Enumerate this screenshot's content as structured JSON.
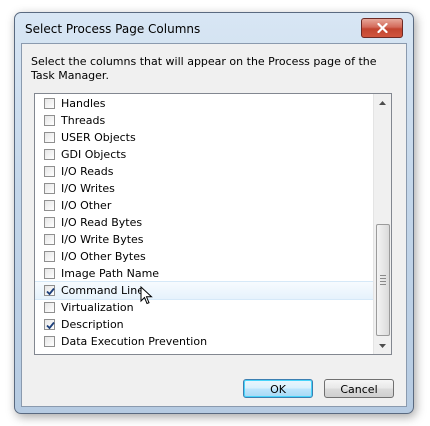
{
  "window": {
    "title": "Select Process Page Columns"
  },
  "instruction": "Select the columns that will appear on the Process page of the Task Manager.",
  "columns": [
    {
      "label": "Handles",
      "checked": false
    },
    {
      "label": "Threads",
      "checked": false
    },
    {
      "label": "USER Objects",
      "checked": false
    },
    {
      "label": "GDI Objects",
      "checked": false
    },
    {
      "label": "I/O Reads",
      "checked": false
    },
    {
      "label": "I/O Writes",
      "checked": false
    },
    {
      "label": "I/O Other",
      "checked": false
    },
    {
      "label": "I/O Read Bytes",
      "checked": false
    },
    {
      "label": "I/O Write Bytes",
      "checked": false
    },
    {
      "label": "I/O Other Bytes",
      "checked": false
    },
    {
      "label": "Image Path Name",
      "checked": false
    },
    {
      "label": "Command Line",
      "checked": true,
      "hovered": true
    },
    {
      "label": "Virtualization",
      "checked": false
    },
    {
      "label": "Description",
      "checked": true
    },
    {
      "label": "Data Execution Prevention",
      "checked": false
    }
  ],
  "buttons": {
    "ok": "OK",
    "cancel": "Cancel"
  },
  "colors": {
    "accent": "#3c7fb1",
    "close": "#c2442f",
    "checkmark": "#1d3f7a"
  }
}
